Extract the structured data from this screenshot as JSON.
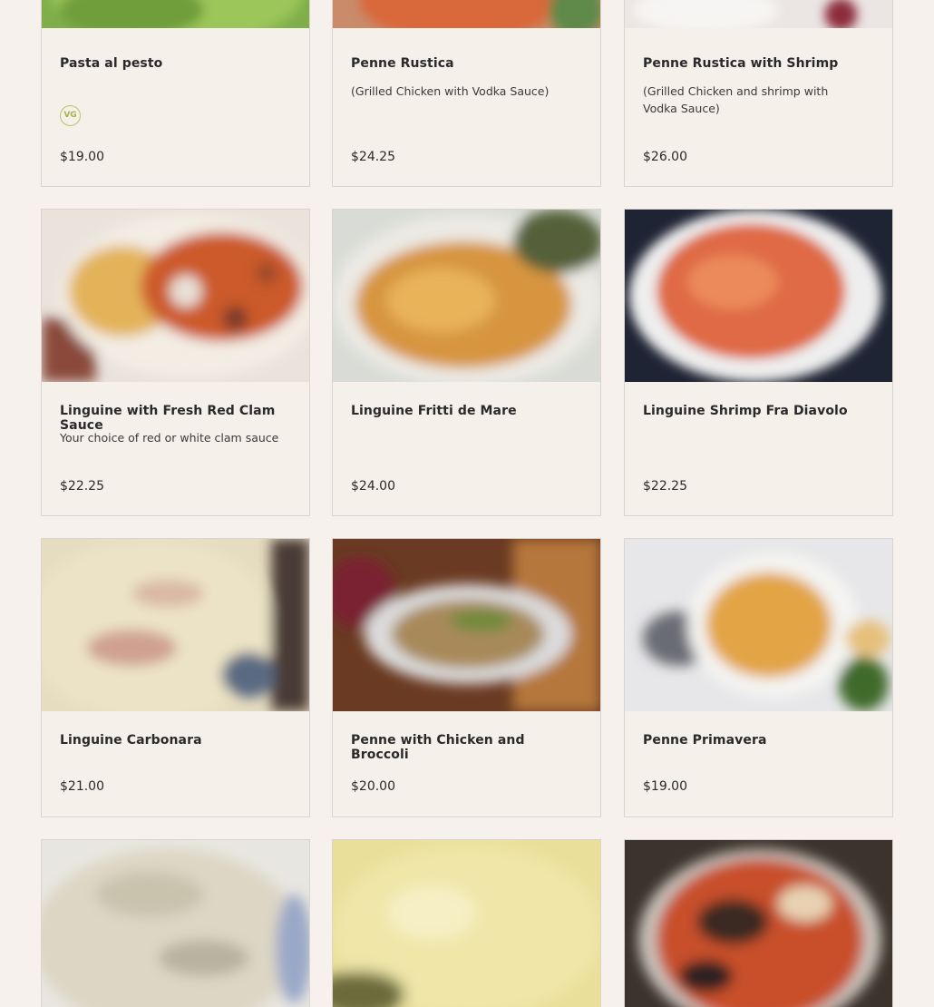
{
  "menu": {
    "items": [
      {
        "name": "Pasta al pesto",
        "description": "",
        "price": "$19.00",
        "badge": "VG"
      },
      {
        "name": "Penne Rustica",
        "description": "(Grilled Chicken with Vodka Sauce)",
        "price": "$24.25"
      },
      {
        "name": "Penne Rustica with Shrimp",
        "description": "(Grilled Chicken and shrimp with Vodka Sauce)",
        "price": "$26.00"
      },
      {
        "name": "Linguine with Fresh Red Clam Sauce",
        "description": "Your choice of red or white clam sauce",
        "price": "$22.25"
      },
      {
        "name": "Linguine Fritti de Mare",
        "description": "",
        "price": "$24.00"
      },
      {
        "name": "Linguine Shrimp Fra Diavolo",
        "description": "",
        "price": "$22.25"
      },
      {
        "name": "Linguine Carbonara",
        "description": "",
        "price": "$21.00"
      },
      {
        "name": "Penne with Chicken and Broccoli",
        "description": "",
        "price": "$20.00"
      },
      {
        "name": "Penne Primavera",
        "description": "",
        "price": "$19.00"
      }
    ]
  },
  "colors": {
    "background": "#f6f1ec",
    "card_border": "#d9d4cf",
    "vegan_badge": "#b9c46a"
  }
}
